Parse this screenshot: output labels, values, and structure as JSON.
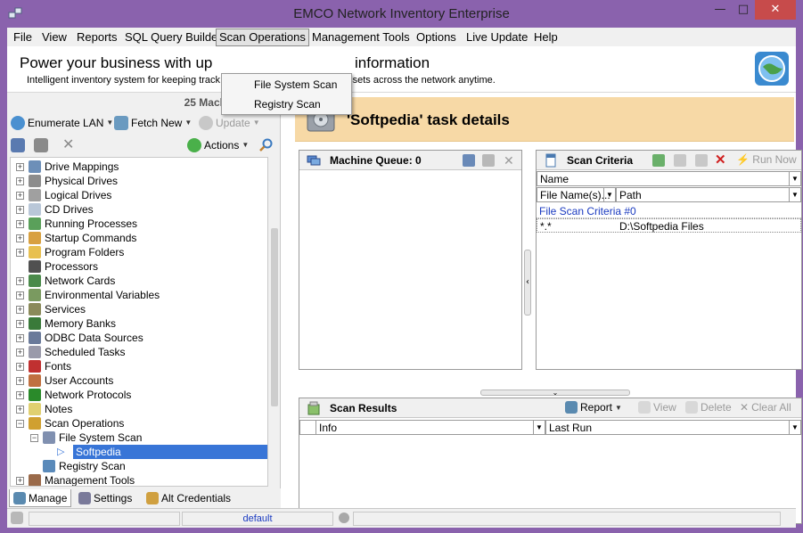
{
  "window": {
    "title": "EMCO Network Inventory Enterprise",
    "min_glyph": "—",
    "max_glyph": "□",
    "close_glyph": "✕"
  },
  "menu": {
    "file": "File",
    "view": "View",
    "reports": "Reports",
    "sql": "SQL Query Builder",
    "scan_ops": "Scan Operations",
    "mgmt": "Management Tools",
    "options": "Options",
    "live_update": "Live Update",
    "help": "Help"
  },
  "dropdown": {
    "items": [
      "File System Scan",
      "Registry Scan"
    ]
  },
  "banner": {
    "headline_left": "Power your business with up",
    "headline_right": "information",
    "sub_left": "Intelligent inventory system for keeping track",
    "sub_right": "assets across the network anytime."
  },
  "left": {
    "trial": "25 Machines Trial",
    "enumerate": "Enumerate LAN",
    "fetch": "Fetch New",
    "update": "Update",
    "actions": "Actions",
    "tree": [
      {
        "label": "Drive Mappings",
        "icon": "drive-mapping-icon",
        "color": "#6d8fb8"
      },
      {
        "label": "Physical Drives",
        "icon": "hard-drive-icon",
        "color": "#8c8c8c"
      },
      {
        "label": "Logical Drives",
        "icon": "logical-drive-icon",
        "color": "#a0a0a0"
      },
      {
        "label": "CD Drives",
        "icon": "cd-icon",
        "color": "#b9c7d8"
      },
      {
        "label": "Running Processes",
        "icon": "process-icon",
        "color": "#5aa05a"
      },
      {
        "label": "Startup Commands",
        "icon": "startup-icon",
        "color": "#d8a040"
      },
      {
        "label": "Program Folders",
        "icon": "folder-icon",
        "color": "#e8c050"
      },
      {
        "label": "Processors",
        "icon": "cpu-icon",
        "color": "#505050"
      },
      {
        "label": "Network Cards",
        "icon": "network-card-icon",
        "color": "#4a8a4a"
      },
      {
        "label": "Environmental Variables",
        "icon": "env-icon",
        "color": "#7a9a60"
      },
      {
        "label": "Services",
        "icon": "services-icon",
        "color": "#8a8a5a"
      },
      {
        "label": "Memory Banks",
        "icon": "memory-icon",
        "color": "#3a7a3a"
      },
      {
        "label": "ODBC Data Sources",
        "icon": "odbc-icon",
        "color": "#6a7a9a"
      },
      {
        "label": "Scheduled Tasks",
        "icon": "tasks-icon",
        "color": "#9a9aaa"
      },
      {
        "label": "Fonts",
        "icon": "font-icon",
        "color": "#c03030"
      },
      {
        "label": "User Accounts",
        "icon": "users-icon",
        "color": "#c07040"
      },
      {
        "label": "Network Protocols",
        "icon": "protocol-icon",
        "color": "#2a8a2a"
      },
      {
        "label": "Notes",
        "icon": "notes-icon",
        "color": "#e0d070"
      },
      {
        "label": "Scan Operations",
        "icon": "scan-icon",
        "color": "#d0a030"
      },
      {
        "label": "File System Scan",
        "icon": "fs-scan-icon",
        "color": "#8090b0"
      },
      {
        "label": "Softpedia",
        "icon": "task-arrow-icon",
        "color": "#3875d7"
      },
      {
        "label": "Registry Scan",
        "icon": "registry-icon",
        "color": "#5a8aba"
      },
      {
        "label": "Management Tools",
        "icon": "mgmt-icon",
        "color": "#9a6a4a"
      }
    ],
    "tabs": {
      "manage": "Manage",
      "settings": "Settings",
      "alt": "Alt Credentials"
    }
  },
  "task": {
    "title": "'Softpedia' task details"
  },
  "queue": {
    "title": "Machine Queue: 0"
  },
  "criteria": {
    "title": "Scan Criteria",
    "run_now": "Run Now",
    "col_name": "Name",
    "col_file": "File Name(s)...",
    "col_path": "Path",
    "group": "File Scan Criteria #0",
    "row_file": "*.*",
    "row_path": "D:\\Softpedia Files"
  },
  "results": {
    "title": "Scan Results",
    "report": "Report",
    "view": "View",
    "delete": "Delete",
    "clear_all": "Clear All",
    "col_info": "Info",
    "col_last": "Last Run"
  },
  "status": {
    "default": "default"
  }
}
